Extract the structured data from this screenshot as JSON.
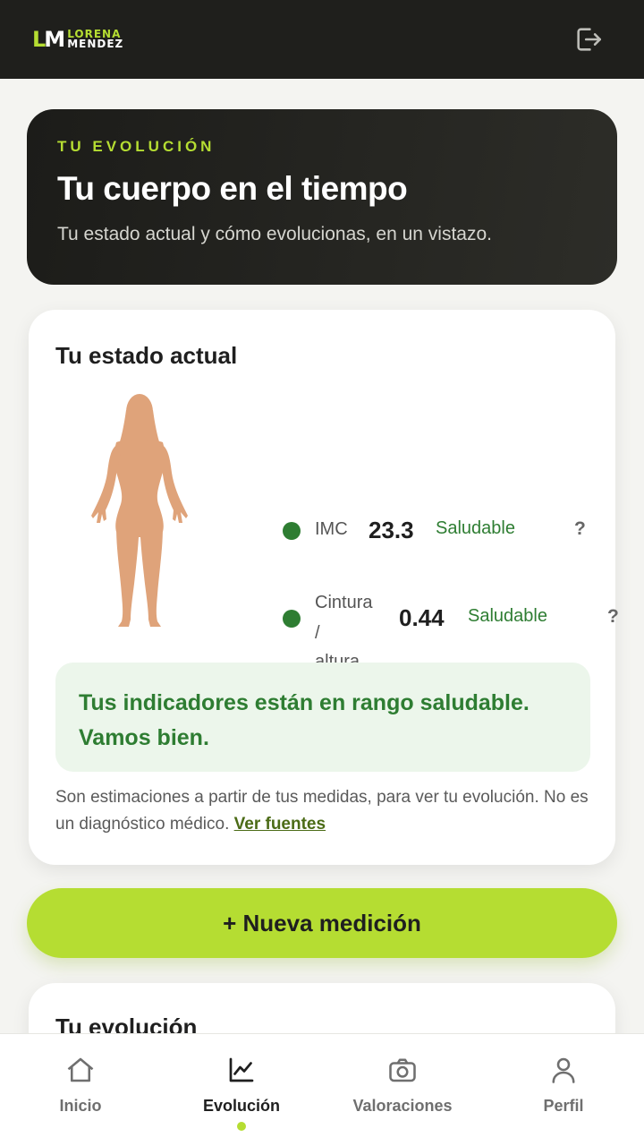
{
  "header": {
    "logo_mark_a": "L",
    "logo_mark_b": "M",
    "logo_line1": "LORENA",
    "logo_line2": "MENDEZ",
    "logout_icon": "logout-icon"
  },
  "hero": {
    "eyebrow": "TU EVOLUCIÓN",
    "title": "Tu cuerpo en el tiempo",
    "subtitle": "Tu estado actual y cómo evolucionas, en un vistazo."
  },
  "estado": {
    "title": "Tu estado actual",
    "metrics": [
      {
        "label": "IMC",
        "value": "23.3",
        "status": "Saludable",
        "help": "?"
      },
      {
        "label_line1": "Cintura",
        "label_line2": "/ altura",
        "value": "0.44",
        "status": "Saludable",
        "help": "?"
      }
    ],
    "banner": "Tus indicadores están en rango saludable. Vamos bien.",
    "disclaimer": "Son estimaciones a partir de tus medidas, para ver tu evolución. No es un diagnóstico médico.",
    "sources_link": "Ver fuentes"
  },
  "cta": {
    "label": "+ Nueva medición"
  },
  "evolucion": {
    "title": "Tu evolución"
  },
  "nav": {
    "items": [
      {
        "label": "Inicio",
        "icon": "home-icon"
      },
      {
        "label": "Evolución",
        "icon": "chart-icon"
      },
      {
        "label": "Valoraciones",
        "icon": "camera-icon"
      },
      {
        "label": "Perfil",
        "icon": "user-icon"
      }
    ],
    "active_index": 1
  },
  "colors": {
    "accent": "#b5dd32",
    "dark": "#1f1f1c",
    "healthy": "#2e7d32",
    "healthy_bg": "#ecf6eb",
    "body": "#dfa37a"
  }
}
